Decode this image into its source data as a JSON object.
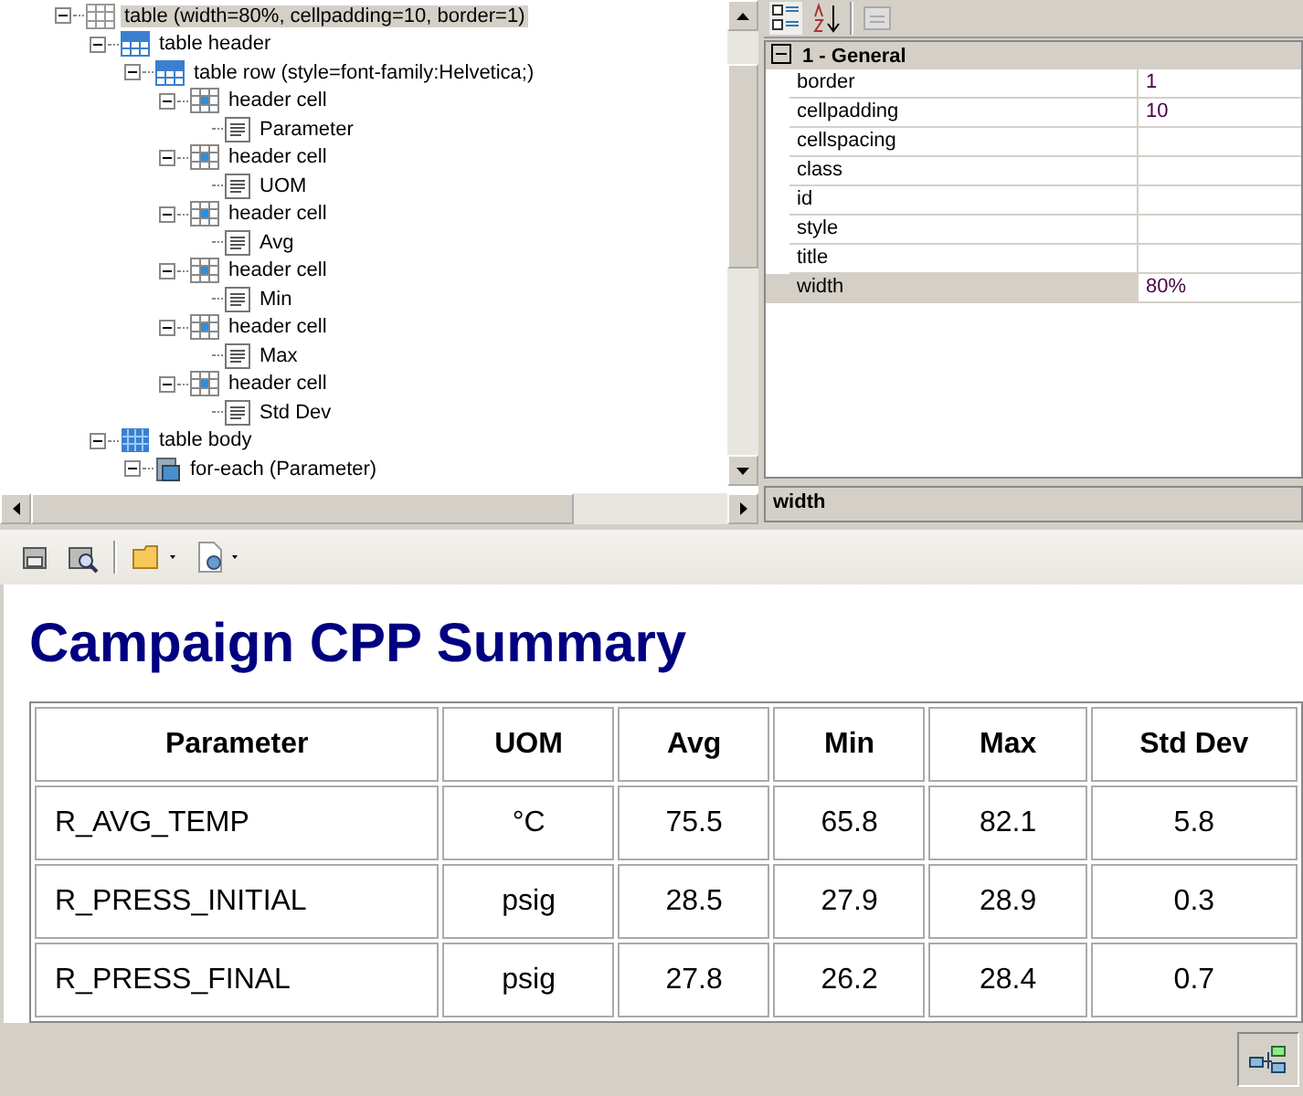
{
  "tree": [
    {
      "kind": "table",
      "label": "table (width=80%, cellpadding=10, border=1)",
      "selected": true,
      "expanded": true,
      "children": [
        {
          "kind": "thead",
          "label": "table header",
          "selected": false,
          "expanded": true,
          "children": [
            {
              "kind": "row",
              "label": "table row (style=font-family:Helvetica;)",
              "selected": false,
              "expanded": true,
              "children": [
                {
                  "kind": "cell",
                  "label": "header cell",
                  "selected": false,
                  "expanded": true,
                  "children": [
                    {
                      "kind": "text",
                      "label": "Parameter",
                      "selected": false
                    }
                  ]
                },
                {
                  "kind": "cell",
                  "label": "header cell",
                  "selected": false,
                  "expanded": true,
                  "children": [
                    {
                      "kind": "text",
                      "label": "UOM",
                      "selected": false
                    }
                  ]
                },
                {
                  "kind": "cell",
                  "label": "header cell",
                  "selected": false,
                  "expanded": true,
                  "children": [
                    {
                      "kind": "text",
                      "label": "Avg",
                      "selected": false
                    }
                  ]
                },
                {
                  "kind": "cell",
                  "label": "header cell",
                  "selected": false,
                  "expanded": true,
                  "children": [
                    {
                      "kind": "text",
                      "label": "Min",
                      "selected": false
                    }
                  ]
                },
                {
                  "kind": "cell",
                  "label": "header cell",
                  "selected": false,
                  "expanded": true,
                  "children": [
                    {
                      "kind": "text",
                      "label": "Max",
                      "selected": false
                    }
                  ]
                },
                {
                  "kind": "cell",
                  "label": "header cell",
                  "selected": false,
                  "expanded": true,
                  "children": [
                    {
                      "kind": "text",
                      "label": "Std Dev",
                      "selected": false
                    }
                  ]
                }
              ]
            }
          ]
        },
        {
          "kind": "tbody",
          "label": "table body",
          "selected": false,
          "expanded": true,
          "children": [
            {
              "kind": "foreach",
              "label": "for-each (Parameter)",
              "selected": false,
              "expanded": true
            }
          ]
        }
      ]
    }
  ],
  "properties": {
    "category": "1 - General",
    "expanded": true,
    "rows": [
      {
        "name": "border",
        "value": "1",
        "selected": false
      },
      {
        "name": "cellpadding",
        "value": "10",
        "selected": false
      },
      {
        "name": "cellspacing",
        "selected": false
      },
      {
        "name": "class",
        "selected": false
      },
      {
        "name": "id",
        "selected": false
      },
      {
        "name": "style",
        "selected": false
      },
      {
        "name": "title",
        "selected": false
      },
      {
        "name": "width",
        "value": "80%",
        "selected": true
      }
    ],
    "description": "width"
  },
  "preview": {
    "heading": "Campaign CPP Summary",
    "columns": [
      "Parameter",
      "UOM",
      "Avg",
      "Min",
      "Max",
      "Std Dev"
    ],
    "rows": [
      [
        "R_AVG_TEMP",
        "°C",
        "75.5",
        "65.8",
        "82.1",
        "5.8"
      ],
      [
        "R_PRESS_INITIAL",
        "psig",
        "28.5",
        "27.9",
        "28.9",
        "0.3"
      ],
      [
        "R_PRESS_FINAL",
        "psig",
        "27.8",
        "26.2",
        "28.4",
        "0.7"
      ]
    ]
  }
}
